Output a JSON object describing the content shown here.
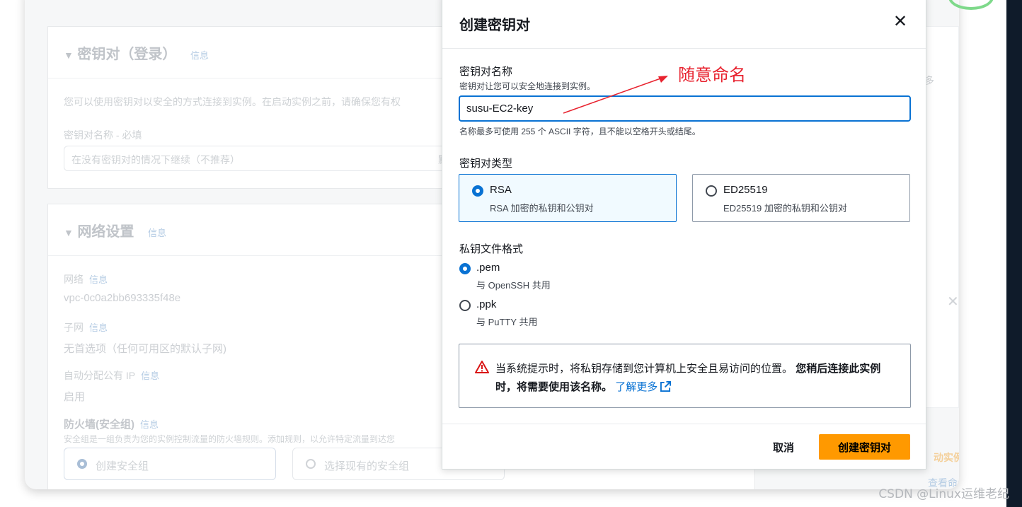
{
  "background": {
    "keypair_section": {
      "title": "密钥对（登录）",
      "info": "信息",
      "description": "您可以使用密钥对以安全的方式连接到实例。在启动实例之前，请确保您有权",
      "name_label": "密钥对名称 - 必填",
      "select_value": "在没有密钥对的情况下继续（不推荐）",
      "select_side": "默"
    },
    "network_section": {
      "title": "网络设置",
      "info": "信息",
      "network_label": "网络",
      "network_value": "vpc-0c0a2bb693335f48e",
      "subnet_label": "子网",
      "subnet_value": "无首选项（任何可用区的默认子网)",
      "public_ip_label": "自动分配公有 IP",
      "public_ip_value": "启用",
      "firewall_label": "防火墙(安全组)",
      "firewall_desc": "安全组是一组负责为您的实例控制流量的防火墙规则。添加规则，以允许特定流量到达您",
      "create_sg": "创建安全组",
      "select_sg": "选择现有的安全组"
    },
    "side_text": {
      "more": "多",
      "launch": "动实例",
      "view": "查看命令"
    }
  },
  "modal": {
    "title": "创建密钥对",
    "close_icon": "close-icon",
    "name_label": "密钥对名称",
    "name_desc": "密钥对让您可以安全地连接到实例。",
    "name_value": "susu-EC2-key",
    "name_constraint": "名称最多可使用 255 个 ASCII 字符，且不能以空格开头或结尾。",
    "type_label": "密钥对类型",
    "types": [
      {
        "label": "RSA",
        "desc": "RSA 加密的私钥和公钥对",
        "selected": true
      },
      {
        "label": "ED25519",
        "desc": "ED25519 加密的私钥和公钥对",
        "selected": false
      }
    ],
    "format_label": "私钥文件格式",
    "formats": [
      {
        "label": ".pem",
        "desc": "与 OpenSSH 共用",
        "selected": true
      },
      {
        "label": ".ppk",
        "desc": "与 PuTTY 共用",
        "selected": false
      }
    ],
    "alert": {
      "text": "当系统提示时，将私钥存储到您计算机上安全且易访问的位置。",
      "bold": "您稍后连接此实例时，将需要使用该名称。",
      "link": "了解更多"
    },
    "cancel_label": "取消",
    "create_label": "创建密钥对"
  },
  "annotation": "随意命名",
  "watermark": "CSDN @Linux运维老纪",
  "colors": {
    "primary": "#0972d3",
    "create_button": "#ff9900",
    "annotation": "#e8232f"
  }
}
